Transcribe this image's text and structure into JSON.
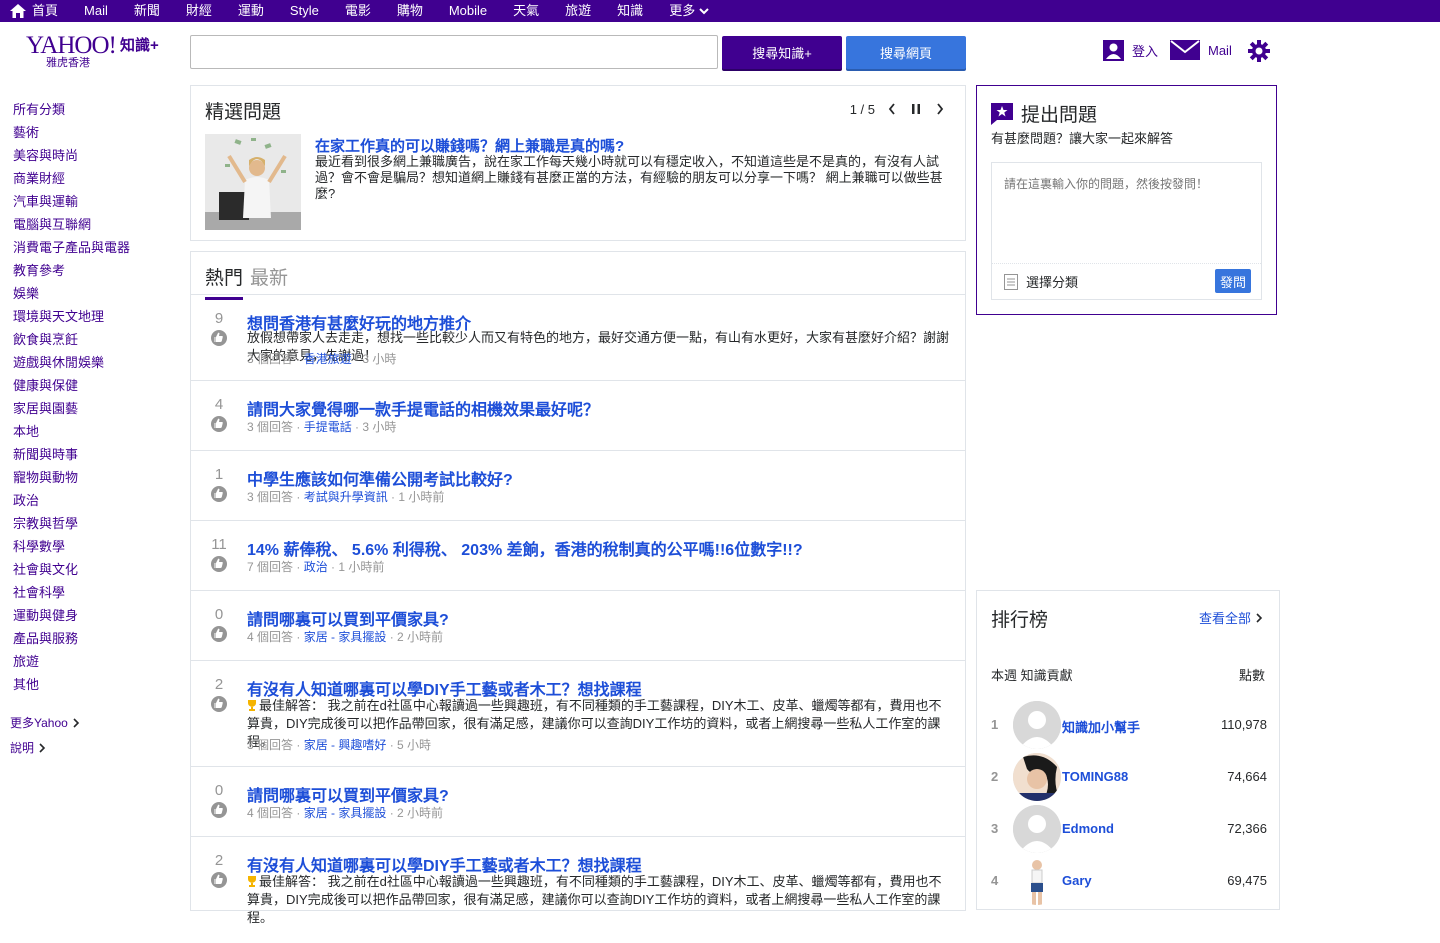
{
  "topnav": [
    "首頁",
    "Mail",
    "新聞",
    "財經",
    "運動",
    "Style",
    "電影",
    "購物",
    "Mobile",
    "天氣",
    "旅遊",
    "知識",
    "更多"
  ],
  "logo": {
    "brand": "YAHOO!",
    "product": "知識+",
    "region": "雅虎香港"
  },
  "search": {
    "placeholder": "",
    "button_zs": "搜尋知識+",
    "button_web": "搜尋網頁"
  },
  "header": {
    "user_label": "登入",
    "mail_label": "Mail"
  },
  "categories": [
    "所有分類",
    "藝術",
    "美容與時尚",
    "商業財經",
    "汽車與運輸",
    "電腦與互聯網",
    "消費電子產品與電器",
    "教育參考",
    "娛樂",
    "環境與天文地理",
    "飲食與烹飪",
    "遊戲與休閒娛樂",
    "健康與保健",
    "家居與園藝",
    "本地",
    "新聞與時事",
    "寵物與動物",
    "政治",
    "宗教與哲學",
    "科學數學",
    "社會與文化",
    "社會科學",
    "運動與健身",
    "產品與服務",
    "旅遊",
    "其他"
  ],
  "leftnav_more": [
    "更多Yahoo",
    "說明"
  ],
  "featured": {
    "title": "精選問題",
    "pager": "1 / 5",
    "question_title": "在家工作真的可以賺錢嗎？網上兼職是真的嗎?",
    "question_body": "最近看到很多網上兼職廣告，說在家工作每天幾小時就可以有穩定收入，不知道這些是不是真的，有沒有人試過？會不會是騙局？想知道網上賺錢有甚麼正當的方法，有經驗的朋友可以分享一下嗎？ 網上兼職可以做些甚麼?"
  },
  "tabs": [
    "熱門",
    "最新"
  ],
  "questions": [
    {
      "votes": "9",
      "title": "想問香港有甚麼好玩的地方推介",
      "desc": "放假想帶家人去走走，想找一些比較少人而又有特色的地方，最好交通方便一點，有山有水更好，大家有甚麼好介紹？謝謝大家的意見，先謝過！",
      "answers": "3 個回答",
      "category": "香港旅遊",
      "time": "3 小時"
    },
    {
      "votes": "4",
      "title": "請問大家覺得哪一款手提電話的相機效果最好呢？",
      "desc": "",
      "answers": "3 個回答",
      "category": "手提電話",
      "time": "3 小時"
    },
    {
      "votes": "1",
      "title": "中學生應該如何準備公開考試比較好?",
      "desc": "",
      "answers": "3 個回答",
      "category": "考試與升學資訊",
      "time": "1 小時前"
    },
    {
      "votes": "11",
      "title": "14% 薪俸稅、 5.6% 利得稅、 203% 差餉，香港的稅制真的公平嗎!!6位數字!!?",
      "desc": "",
      "answers": "7 個回答",
      "category": "政治",
      "time": "1 小時前"
    },
    {
      "votes": "0",
      "title": "請問哪裏可以買到平價家具?",
      "desc": "",
      "answers": "4 個回答",
      "category": "家居 - 家具擺設",
      "time": "2 小時前"
    },
    {
      "votes": "2",
      "title": "有沒有人知道哪裏可以學DIY手工藝或者木工？想找課程",
      "desc": "最佳解答： 我之前在d社區中心報讀過一些興趣班，有不同種類的手工藝課程，DIY木工、皮革、蠟燭等都有，費用也不算貴，DIY完成後可以把作品帶回家，很有滿足感，建議你可以查詢DIY工作坊的資料，或者上網搜尋一些私人工作室的課程。",
      "answers": "3 個回答",
      "category": "家居 - 興趣嗜好",
      "time": "5 小時"
    },
    {
      "votes": "0",
      "title": "請問哪裏可以買到平價家具?",
      "desc": "",
      "answers": "4 個回答",
      "category": "家居 - 家具擺設",
      "time": "2 小時前"
    },
    {
      "votes": "2",
      "title": "有沒有人知道哪裏可以學DIY手工藝或者木工？想找課程",
      "desc": "最佳解答： 我之前在d社區中心報讀過一些興趣班，有不同種類的手工藝課程，DIY木工、皮革、蠟燭等都有，費用也不算貴，DIY完成後可以把作品帶回家，很有滿足感，建議你可以查詢DIY工作坊的資料，或者上網搜尋一些私人工作室的課程。",
      "answers": "",
      "category": "",
      "time": ""
    }
  ],
  "ask": {
    "title": "提出問題",
    "subtitle": "有甚麼問題？讓大家一起來解答",
    "placeholder": "請在這裏輸入你的問題，然後按發問！",
    "category_label": "選擇分類",
    "submit": "發問"
  },
  "leaderboard": {
    "title": "排行榜",
    "view_all": "查看全部",
    "header_left": "本週 知識貢獻",
    "header_right": "點數",
    "rows": [
      {
        "rank": "1",
        "name": "知識加小幫手",
        "points": "110,978"
      },
      {
        "rank": "2",
        "name": "TOMING88",
        "points": "74,664"
      },
      {
        "rank": "3",
        "name": "Edmond",
        "points": "72,366"
      },
      {
        "rank": "4",
        "name": "Gary",
        "points": "69,475"
      }
    ]
  },
  "colors": {
    "brand": "#400090",
    "link": "#1d4ed8",
    "button_blue": "#3775dd"
  }
}
